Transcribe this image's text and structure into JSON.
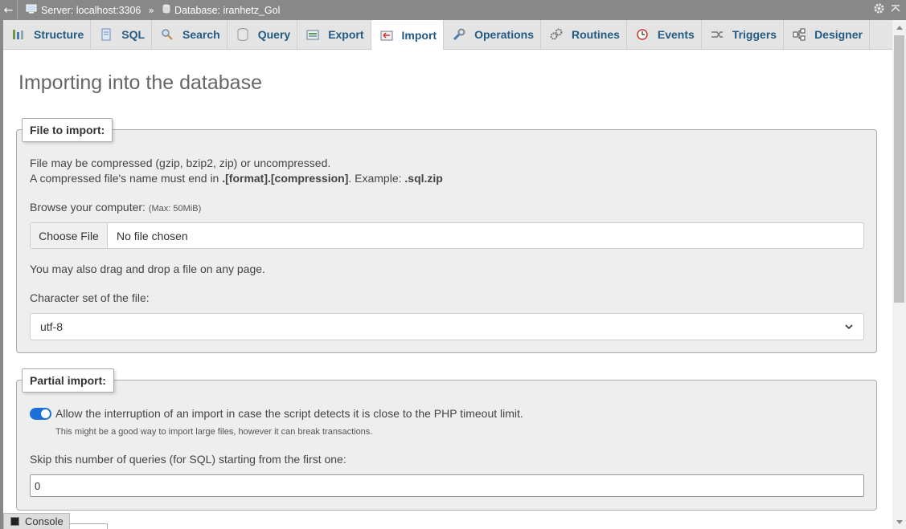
{
  "breadcrumb": {
    "back_icon": "arrow-left-icon",
    "server": "Server: localhost:3306",
    "separator": "»",
    "database": "Database: iranhetz_Gol"
  },
  "tabs": [
    {
      "label": "Structure",
      "icon": "structure-icon"
    },
    {
      "label": "SQL",
      "icon": "sql-icon"
    },
    {
      "label": "Search",
      "icon": "search-icon"
    },
    {
      "label": "Query",
      "icon": "query-icon"
    },
    {
      "label": "Export",
      "icon": "export-icon"
    },
    {
      "label": "Import",
      "icon": "import-icon",
      "active": true
    },
    {
      "label": "Operations",
      "icon": "wrench-icon"
    },
    {
      "label": "Routines",
      "icon": "routines-icon"
    },
    {
      "label": "Events",
      "icon": "clock-icon"
    },
    {
      "label": "Triggers",
      "icon": "triggers-icon"
    },
    {
      "label": "Designer",
      "icon": "designer-icon"
    }
  ],
  "page_title": "Importing into the database",
  "file_section": {
    "legend": "File to import:",
    "line1": "File may be compressed (gzip, bzip2, zip) or uncompressed.",
    "line2_prefix": "A compressed file's name must end in ",
    "line2_bold": ".[format].[compression]",
    "line2_mid": ". Example: ",
    "line2_example": ".sql.zip",
    "browse_label": "Browse your computer: ",
    "browse_max": "(Max: 50MiB)",
    "choose_file_button": "Choose File",
    "no_file": "No file chosen",
    "drag_drop": "You may also drag and drop a file on any page.",
    "charset_label": "Character set of the file:",
    "charset_value": "utf-8"
  },
  "partial_section": {
    "legend": "Partial import:",
    "allow_interrupt_label": "Allow the interruption of an import in case the script detects it is close to the PHP timeout limit.",
    "allow_interrupt_on": true,
    "hint": "This might be a good way to import large files, however it can break transactions.",
    "skip_label": "Skip this number of queries (for SQL) starting from the first one:",
    "skip_value": "0"
  },
  "console_label": "Console",
  "colors": {
    "tab_text": "#235a81",
    "toggle_on": "#1a6fd8",
    "breadcrumb_bg": "#888888"
  }
}
